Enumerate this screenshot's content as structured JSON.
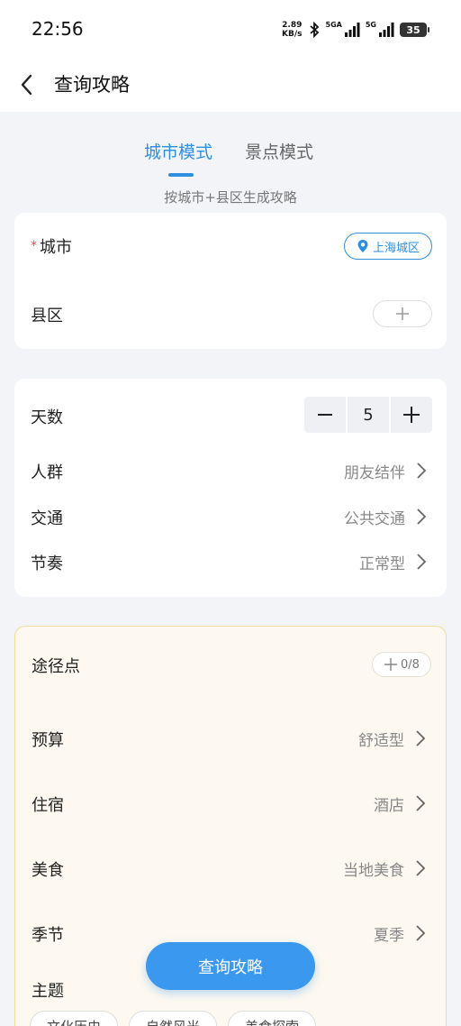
{
  "status_bar": {
    "time": "22:56",
    "speed_value": "2.89",
    "speed_unit": "KB/s",
    "network1": "5GA",
    "network2": "5G",
    "battery": "35"
  },
  "header": {
    "title": "查询攻略"
  },
  "tabs": [
    {
      "label": "城市模式",
      "active": true
    },
    {
      "label": "景点模式",
      "active": false
    }
  ],
  "subtitle": "按城市+县区生成攻略",
  "city_card": {
    "city_required_mark": "*",
    "city_label": "城市",
    "city_value": "上海城区",
    "district_label": "县区"
  },
  "trip_card": {
    "days_label": "天数",
    "days_value": "5",
    "crowd_label": "人群",
    "crowd_value": "朋友结伴",
    "transport_label": "交通",
    "transport_value": "公共交通",
    "pace_label": "节奏",
    "pace_value": "正常型"
  },
  "options_card": {
    "waypoint_label": "途径点",
    "waypoint_count": "0/8",
    "budget_label": "预算",
    "budget_value": "舒适型",
    "stay_label": "住宿",
    "stay_value": "酒店",
    "food_label": "美食",
    "food_value": "当地美食",
    "season_label": "季节",
    "season_value": "夏季",
    "theme_label": "主题",
    "themes": [
      "文化历史",
      "自然风光",
      "美食探索"
    ]
  },
  "query_button": "查询攻略",
  "colors": {
    "accent": "#3b98ef",
    "required": "#e34b4b",
    "highlight_border": "#f2dc9c"
  }
}
